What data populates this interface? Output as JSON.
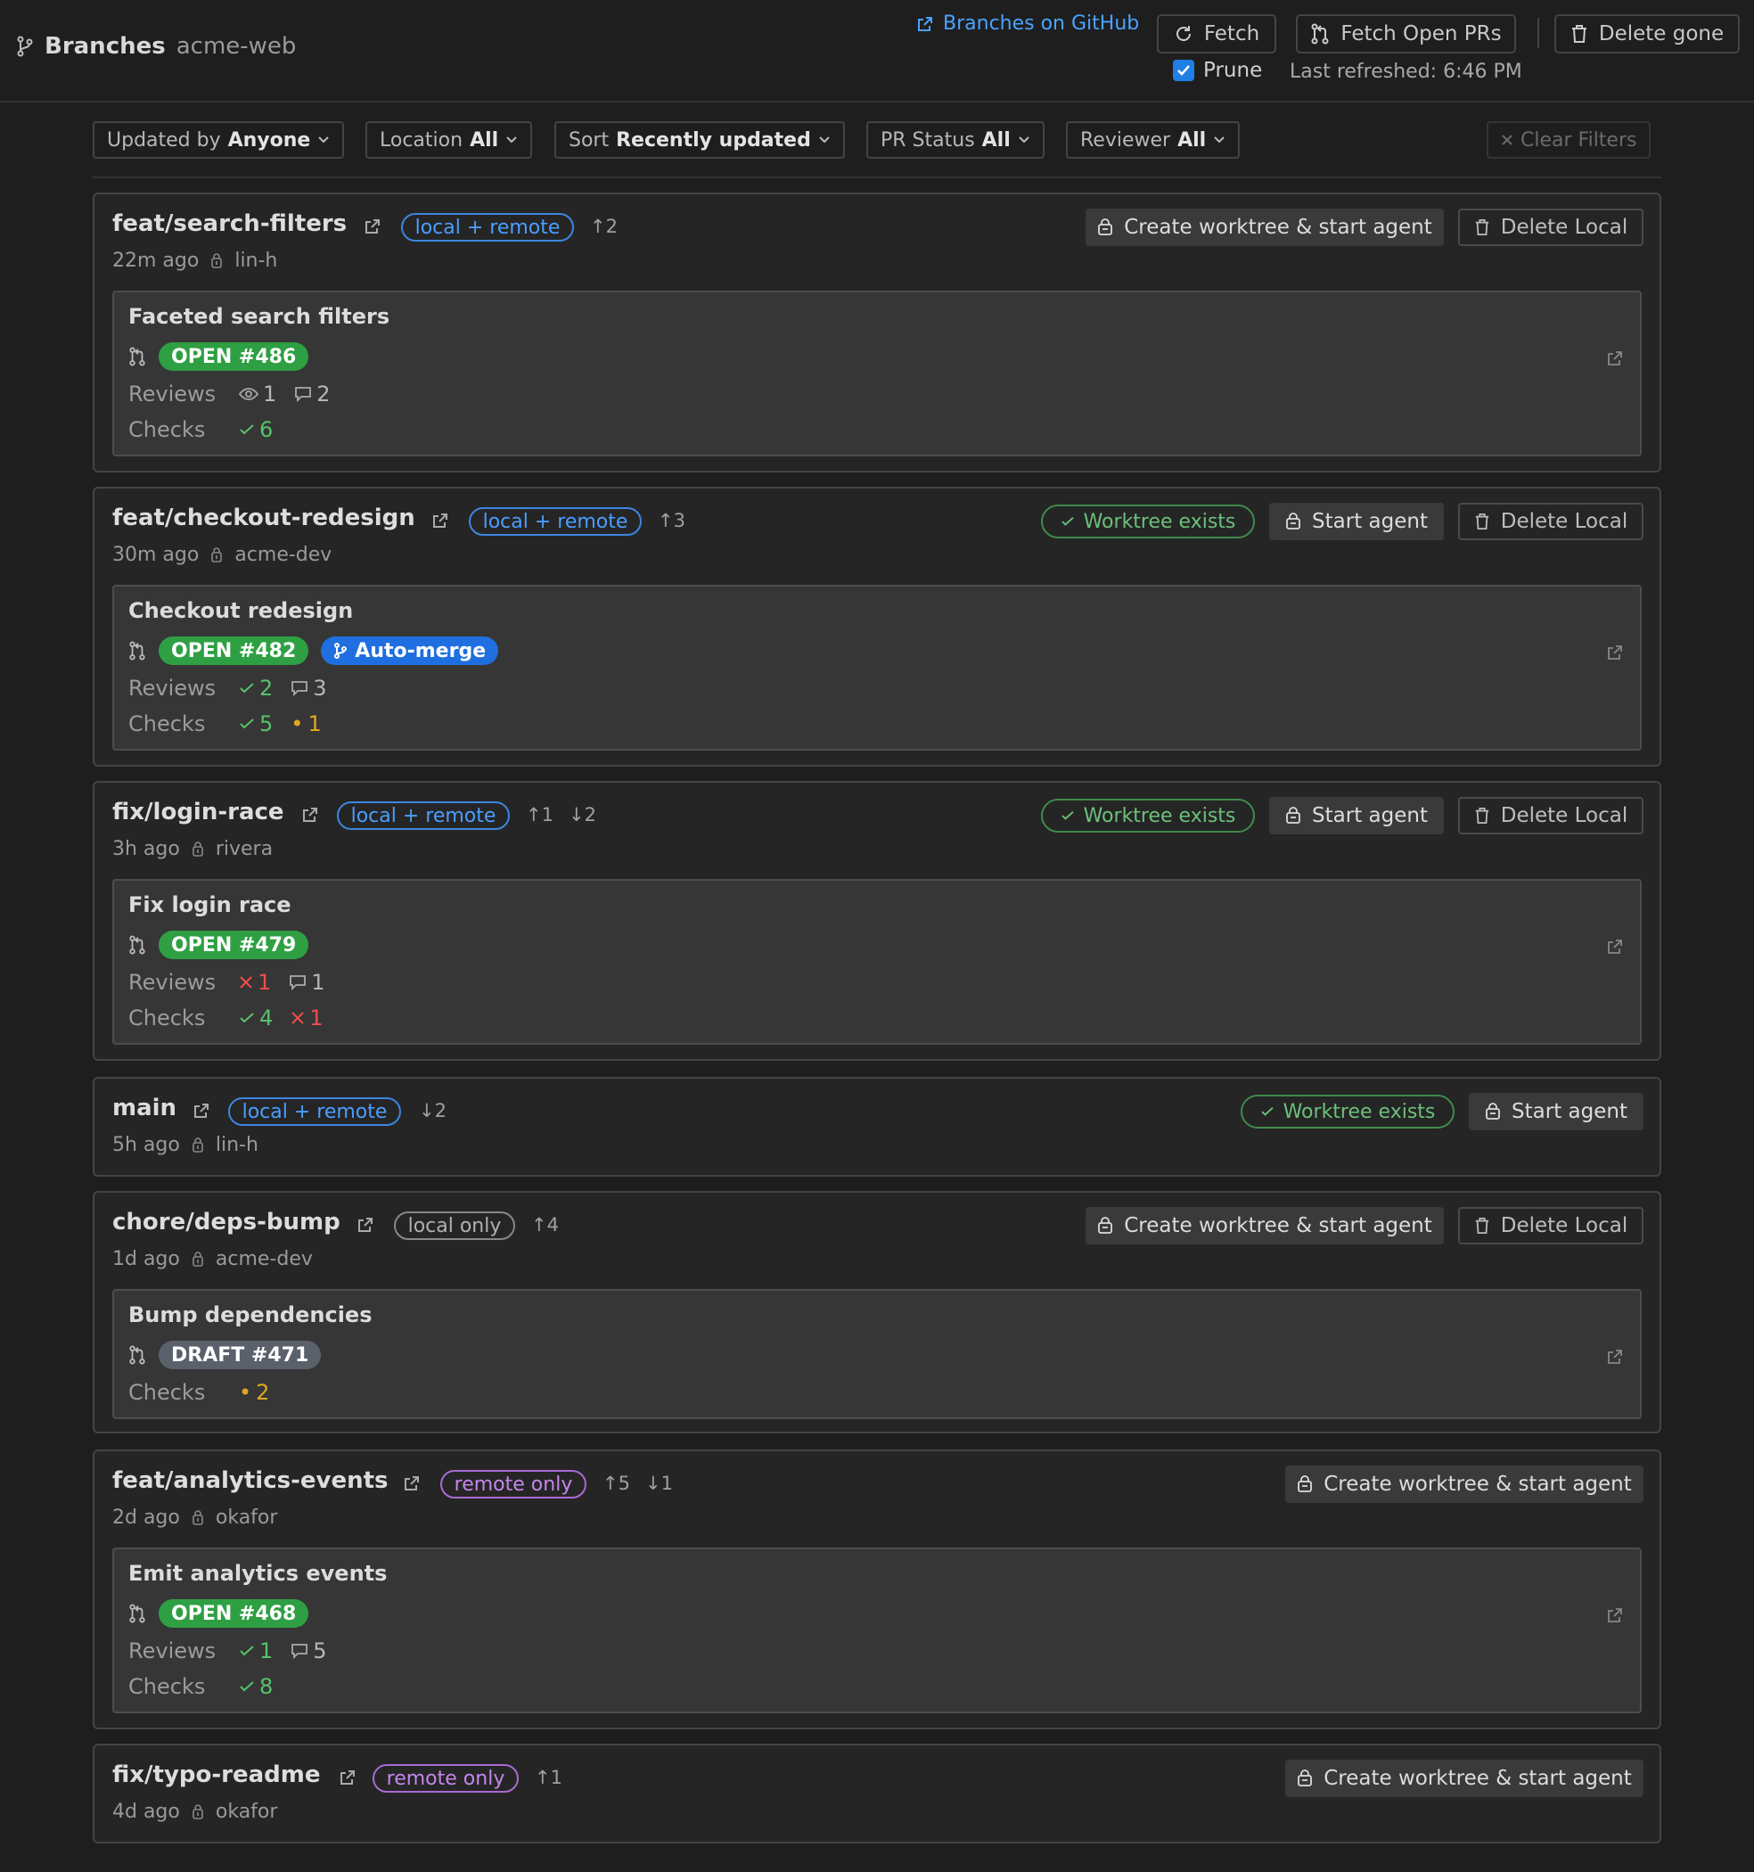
{
  "header": {
    "title": "Branches",
    "repo": "acme-web",
    "github_link": "Branches on GitHub",
    "fetch": "Fetch",
    "fetch_prs": "Fetch Open PRs",
    "delete_gone": "Delete gone",
    "prune_label": "Prune",
    "prune_checked": true,
    "last_refreshed": "Last refreshed: 6:46 PM"
  },
  "filters": {
    "updated_by": {
      "label": "Updated by",
      "value": "Anyone"
    },
    "location": {
      "label": "Location",
      "value": "All"
    },
    "sort": {
      "label": "Sort",
      "value": "Recently updated"
    },
    "pr_status": {
      "label": "PR Status",
      "value": "All"
    },
    "reviewer": {
      "label": "Reviewer",
      "value": "All"
    },
    "clear": "Clear Filters"
  },
  "labels": {
    "reviews": "Reviews",
    "checks": "Checks",
    "create_agent": "Create worktree & start agent",
    "start_agent": "Start agent",
    "delete_local": "Delete Local",
    "worktree_exists": "Worktree exists"
  },
  "branches": [
    {
      "name": "feat/search-filters",
      "location": "local + remote",
      "ahead": "↑2",
      "behind": "",
      "time": "22m ago",
      "author": "lin-h",
      "pr": {
        "title": "Faceted search filters",
        "status": "OPEN #486",
        "automerge": "",
        "reviews": {
          "viewed": "1",
          "comments": "2"
        },
        "checks": {
          "passed": "6"
        }
      }
    },
    {
      "name": "feat/checkout-redesign",
      "location": "local + remote",
      "ahead": "↑3",
      "behind": "",
      "time": "30m ago",
      "author": "acme-dev",
      "pr": {
        "title": "Checkout redesign",
        "status": "OPEN #482",
        "automerge": "Auto-merge",
        "reviews": {
          "approved": "2",
          "comments": "3"
        },
        "checks": {
          "passed": "5",
          "pending": "1"
        }
      }
    },
    {
      "name": "fix/login-race",
      "location": "local + remote",
      "ahead": "↑1",
      "behind": "↓2",
      "time": "3h ago",
      "author": "rivera",
      "pr": {
        "title": "Fix login race",
        "status": "OPEN #479",
        "automerge": "",
        "reviews": {
          "changes": "1",
          "comments": "1"
        },
        "checks": {
          "passed": "4",
          "failed": "1"
        }
      }
    },
    {
      "name": "main",
      "location": "local + remote",
      "ahead": "",
      "behind": "↓2",
      "time": "5h ago",
      "author": "lin-h",
      "pr": null
    },
    {
      "name": "chore/deps-bump",
      "location": "local only",
      "ahead": "↑4",
      "behind": "",
      "time": "1d ago",
      "author": "acme-dev",
      "pr": {
        "title": "Bump dependencies",
        "status": "DRAFT #471",
        "automerge": "",
        "reviews": null,
        "checks": {
          "pending": "2"
        }
      }
    },
    {
      "name": "feat/analytics-events",
      "location": "remote only",
      "ahead": "↑5",
      "behind": "↓1",
      "time": "2d ago",
      "author": "okafor",
      "pr": {
        "title": "Emit analytics events",
        "status": "OPEN #468",
        "automerge": "",
        "reviews": {
          "approved": "1",
          "comments": "5"
        },
        "checks": {
          "passed": "8"
        }
      }
    },
    {
      "name": "fix/typo-readme",
      "location": "remote only",
      "ahead": "↑1",
      "behind": "",
      "time": "4d ago",
      "author": "okafor",
      "pr": null
    }
  ],
  "colors": {
    "accent": "#4aa3ff",
    "open": "#2ea043",
    "draft": "#5b616b",
    "automerge": "#1f6fe0",
    "success": "#56c26a",
    "failure": "#f14c4c",
    "pending": "#e0a820",
    "remote_only": "#c586ea"
  }
}
